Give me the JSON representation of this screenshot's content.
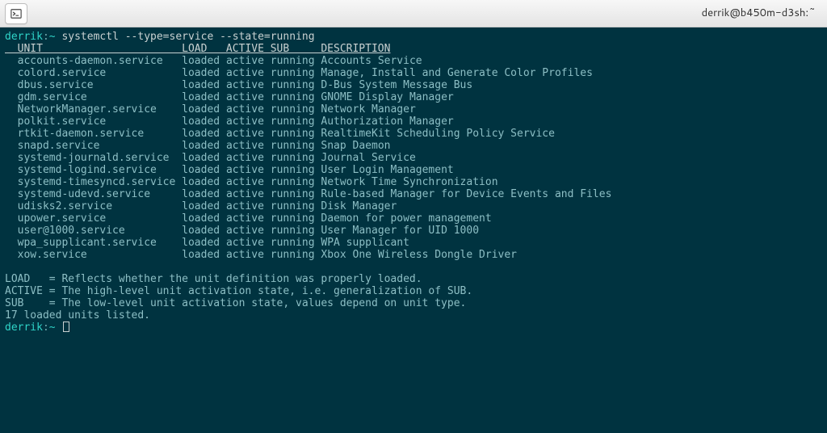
{
  "window": {
    "title": "derrik@b450m-d3sh:~"
  },
  "prompt": {
    "user_host": "derrik",
    "sep": ":",
    "path": "~",
    "symbol": " "
  },
  "command": "systemctl --type=service --state=running",
  "columns": {
    "unit": "UNIT",
    "load": "LOAD",
    "active": "ACTIVE",
    "sub": "SUB",
    "description": "DESCRIPTION"
  },
  "widths": {
    "indent": 2,
    "unit": 26,
    "load": 7,
    "active": 7,
    "sub": 8
  },
  "services": [
    {
      "unit": "accounts-daemon.service",
      "load": "loaded",
      "active": "active",
      "sub": "running",
      "description": "Accounts Service"
    },
    {
      "unit": "colord.service",
      "load": "loaded",
      "active": "active",
      "sub": "running",
      "description": "Manage, Install and Generate Color Profiles"
    },
    {
      "unit": "dbus.service",
      "load": "loaded",
      "active": "active",
      "sub": "running",
      "description": "D-Bus System Message Bus"
    },
    {
      "unit": "gdm.service",
      "load": "loaded",
      "active": "active",
      "sub": "running",
      "description": "GNOME Display Manager"
    },
    {
      "unit": "NetworkManager.service",
      "load": "loaded",
      "active": "active",
      "sub": "running",
      "description": "Network Manager"
    },
    {
      "unit": "polkit.service",
      "load": "loaded",
      "active": "active",
      "sub": "running",
      "description": "Authorization Manager"
    },
    {
      "unit": "rtkit-daemon.service",
      "load": "loaded",
      "active": "active",
      "sub": "running",
      "description": "RealtimeKit Scheduling Policy Service"
    },
    {
      "unit": "snapd.service",
      "load": "loaded",
      "active": "active",
      "sub": "running",
      "description": "Snap Daemon"
    },
    {
      "unit": "systemd-journald.service",
      "load": "loaded",
      "active": "active",
      "sub": "running",
      "description": "Journal Service"
    },
    {
      "unit": "systemd-logind.service",
      "load": "loaded",
      "active": "active",
      "sub": "running",
      "description": "User Login Management"
    },
    {
      "unit": "systemd-timesyncd.service",
      "load": "loaded",
      "active": "active",
      "sub": "running",
      "description": "Network Time Synchronization"
    },
    {
      "unit": "systemd-udevd.service",
      "load": "loaded",
      "active": "active",
      "sub": "running",
      "description": "Rule-based Manager for Device Events and Files"
    },
    {
      "unit": "udisks2.service",
      "load": "loaded",
      "active": "active",
      "sub": "running",
      "description": "Disk Manager"
    },
    {
      "unit": "upower.service",
      "load": "loaded",
      "active": "active",
      "sub": "running",
      "description": "Daemon for power management"
    },
    {
      "unit": "user@1000.service",
      "load": "loaded",
      "active": "active",
      "sub": "running",
      "description": "User Manager for UID 1000"
    },
    {
      "unit": "wpa_supplicant.service",
      "load": "loaded",
      "active": "active",
      "sub": "running",
      "description": "WPA supplicant"
    },
    {
      "unit": "xow.service",
      "load": "loaded",
      "active": "active",
      "sub": "running",
      "description": "Xbox One Wireless Dongle Driver"
    }
  ],
  "legend": {
    "load": "LOAD   = Reflects whether the unit definition was properly loaded.",
    "active": "ACTIVE = The high-level unit activation state, i.e. generalization of SUB.",
    "sub": "SUB    = The low-level unit activation state, values depend on unit type."
  },
  "summary": "17 loaded units listed."
}
